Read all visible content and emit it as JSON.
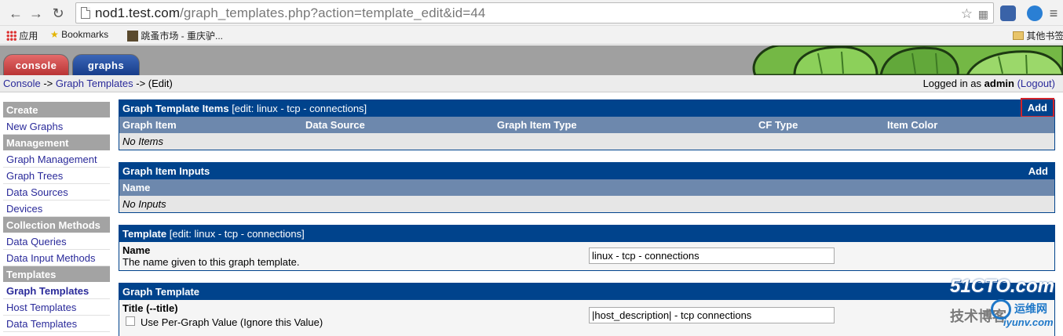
{
  "browser": {
    "url_host": "nod1.test.com",
    "url_path": "/graph_templates.php?action=template_edit&id=44",
    "bookmarks": [
      {
        "icon": "apps-icon",
        "label": "应用"
      },
      {
        "icon": "star-icon",
        "label": "Bookmarks"
      },
      {
        "icon": "site-icon",
        "label": "跳蚤市场 - 重庆驴..."
      }
    ],
    "other_bookmarks": "其他书签",
    "items_label": "Items"
  },
  "tabs": {
    "console": "console",
    "graphs": "graphs"
  },
  "breadcrumb": {
    "console": "Console",
    "sep1": " -> ",
    "graph_templates": "Graph Templates",
    "sep2": " -> ",
    "current": "(Edit)",
    "logged_prefix": "Logged in as ",
    "user": "admin",
    "logout": "(Logout)"
  },
  "sidebar": [
    {
      "type": "header",
      "label": "Create"
    },
    {
      "type": "item",
      "label": "New Graphs"
    },
    {
      "type": "header",
      "label": "Management"
    },
    {
      "type": "item",
      "label": "Graph Management"
    },
    {
      "type": "item",
      "label": "Graph Trees"
    },
    {
      "type": "item",
      "label": "Data Sources"
    },
    {
      "type": "item",
      "label": "Devices"
    },
    {
      "type": "header",
      "label": "Collection Methods"
    },
    {
      "type": "item",
      "label": "Data Queries"
    },
    {
      "type": "item",
      "label": "Data Input Methods"
    },
    {
      "type": "header",
      "label": "Templates"
    },
    {
      "type": "item",
      "label": "Graph Templates",
      "active": true
    },
    {
      "type": "item",
      "label": "Host Templates"
    },
    {
      "type": "item",
      "label": "Data Templates"
    }
  ],
  "items_panel": {
    "title": "Graph Template Items",
    "subtitle": " [edit: linux - tcp - connections]",
    "add": "Add",
    "columns": [
      "Graph Item",
      "Data Source",
      "Graph Item Type",
      "CF Type",
      "Item Color"
    ],
    "empty": "No Items"
  },
  "inputs_panel": {
    "title": "Graph Item Inputs",
    "add": "Add",
    "column": "Name",
    "empty": "No Inputs"
  },
  "template_panel": {
    "title": "Template",
    "subtitle": " [edit: linux - tcp - connections]",
    "name_label": "Name",
    "name_desc": "The name given to this graph template.",
    "name_value": "linux - tcp - connections"
  },
  "graph_template_panel": {
    "title": "Graph Template",
    "title_label": "Title (--title)",
    "checkbox_label": "Use Per-Graph Value (Ignore this Value)",
    "title_value": "|host_description| - tcp connections"
  },
  "watermark": {
    "brand": "51CTO.com",
    "line2": "技术博客",
    "site": "运维网",
    "domain": "iyunv.com"
  },
  "colors": {
    "panel_blue": "#00438c",
    "header_blue": "#6d88ad",
    "highlight_red": "#d2232a"
  }
}
